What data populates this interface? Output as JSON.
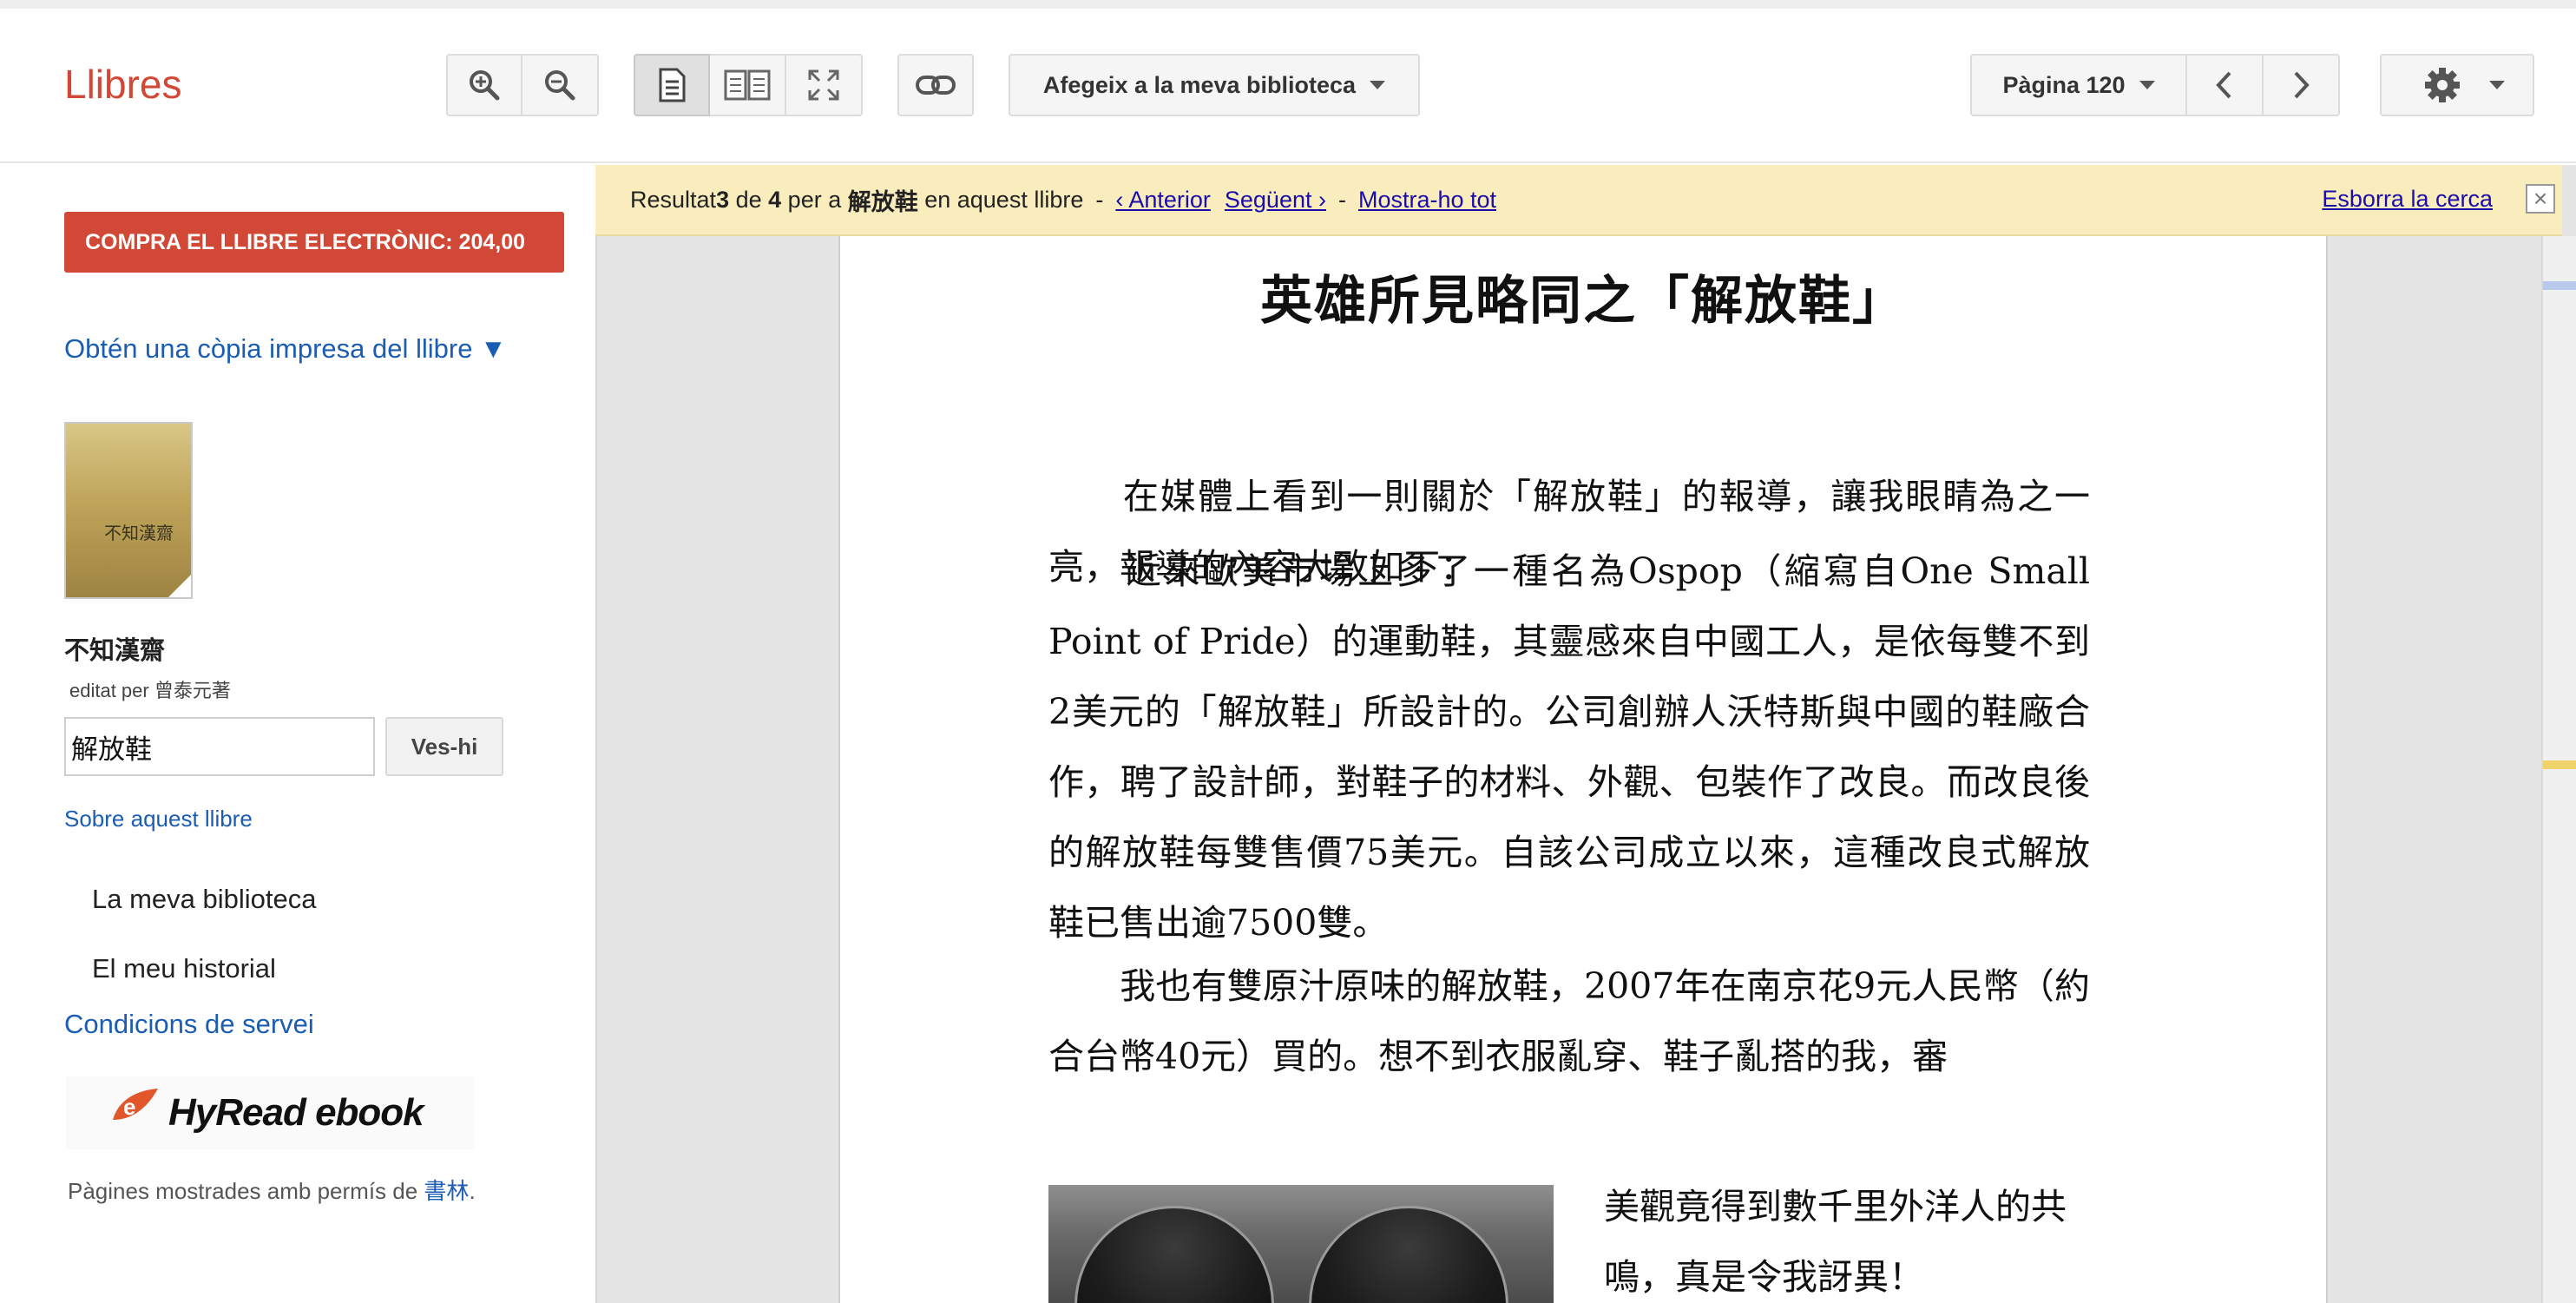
{
  "header": {
    "logo": "Llibres",
    "add_to_library_label": "Afegeix a la meva biblioteca",
    "page_label": "Pàgina 120",
    "icons": [
      "zoom-in-icon",
      "zoom-out-icon",
      "single-page-icon",
      "two-page-icon",
      "fullscreen-icon",
      "link-icon",
      "chevron-left-icon",
      "chevron-right-icon",
      "gear-icon",
      "caret-down-icon"
    ]
  },
  "sidebar": {
    "buy_button": "COMPRA EL LLIBRE ELECTRÒNIC: 204,00",
    "print_copy": "Obtén una còpia impresa del llibre ▼",
    "cover_text": "不知漢齋",
    "book_title": "不知漢齋",
    "editor": "editat per 曾泰元著",
    "search_value": "解放鞋",
    "go_button": "Ves-hi",
    "about_link": "Sobre aquest llibre",
    "nav": [
      "La meva biblioteca",
      "El meu historial"
    ],
    "terms": "Condicions de servei",
    "partner_logo": "HyRead ebook",
    "permission_prefix": "Pàgines mostrades amb permís de ",
    "permission_publisher": "書林",
    "permission_suffix": "."
  },
  "search_bar": {
    "prefix": "Resultat ",
    "current": "3",
    "of": " de ",
    "total": "4",
    "per_a": " per a ",
    "query": "解放鞋",
    "in_book": " en aquest llibre",
    "dash1": "-",
    "prev": "‹ Anterior",
    "next": "Següent ›",
    "dash2": "-",
    "show_all": "Mostra-ho tot",
    "clear": "Esborra la cerca",
    "close": "×"
  },
  "page": {
    "title": "英雄所見略同之「解放鞋」",
    "paragraphs": [
      "　　在媒體上看到一則關於「解放鞋」的報導，讓我眼睛為之一亮，報導的內容大致如下：",
      "　　近來歐美市場上多了一種名為Ospop（縮寫自One Small Point of Pride）的運動鞋，其靈感來自中國工人，是依每雙不到2美元的「解放鞋」所設計的。公司創辦人沃特斯與中國的鞋廠合作，聘了設計師，對鞋子的材料、外觀、包裝作了改良。而改良後的解放鞋每雙售價75美元。自該公司成立以來，這種改良式解放鞋已售出逾7500雙。",
      "　　我也有雙原汁原味的解放鞋，2007年在南京花9元人民幣（約合台幣40元）買的。想不到衣服亂穿、鞋子亂搭的我，審"
    ],
    "side_text": "美觀竟得到數千里外洋人的共鳴，真是令我訝異！"
  },
  "colors": {
    "brand": "#d14836",
    "link": "#1a5db3",
    "search_bar_bg": "#f9edbe"
  }
}
